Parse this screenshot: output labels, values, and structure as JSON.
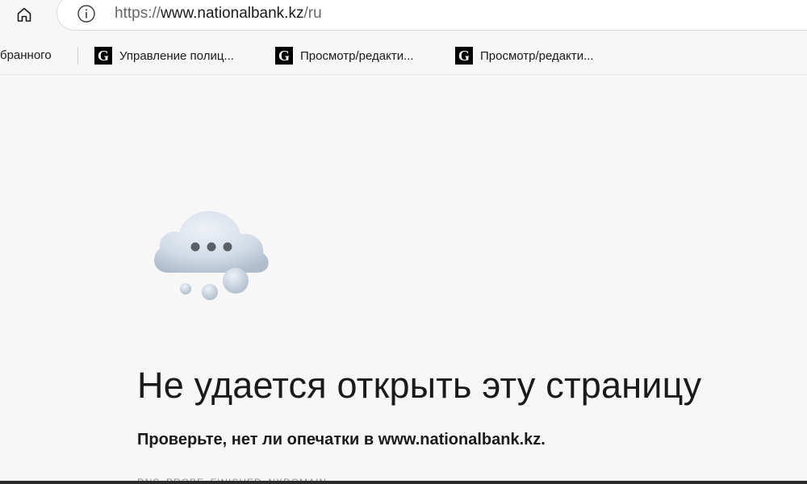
{
  "address_bar": {
    "url_protocol": "https://",
    "url_host": "www.nationalbank.kz",
    "url_path": "/ru"
  },
  "favorites_bar": {
    "overflow_label": "бранного",
    "items": [
      {
        "icon": "G",
        "label": "Управление полиц..."
      },
      {
        "icon": "G",
        "label": "Просмотр/редакти..."
      },
      {
        "icon": "G",
        "label": "Просмотр/редакти..."
      }
    ]
  },
  "error": {
    "title": "Не удается открыть эту страницу",
    "subtitle": "Проверьте, нет ли опечатки в www.nationalbank.kz.",
    "code": "DNS_PROBE_FINISHED_NXDOMAIN"
  },
  "colors": {
    "page_background": "#f7f7f7",
    "cloud": "#c8d3e0",
    "text": "#1a1a1a",
    "favicon_background": "#000000"
  }
}
